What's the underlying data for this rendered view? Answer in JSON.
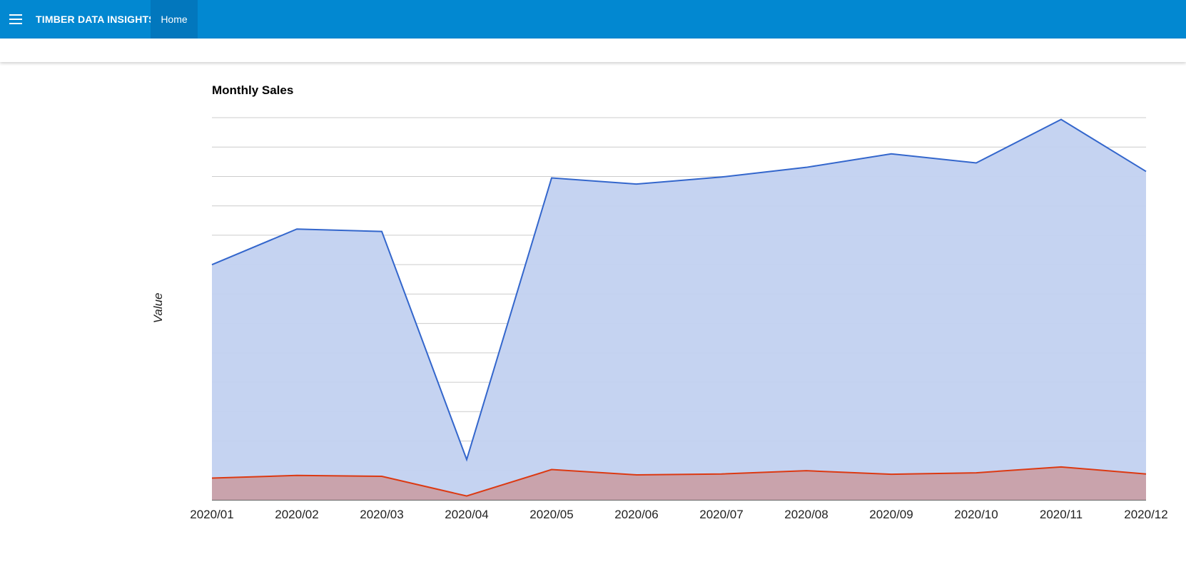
{
  "app": {
    "title": "TIMBER DATA INSIGHTS"
  },
  "nav": {
    "home_label": "Home"
  },
  "icons": {
    "menu": "menu-icon"
  },
  "colors": {
    "appbar": "#0288d1",
    "nav_active": "#0277bd",
    "series_1": "#3366cc",
    "series_1_fill": "#c2d1f0",
    "series_2": "#dc3912",
    "series_2_fill": "#c9a0a8"
  },
  "chart_data": {
    "type": "area",
    "title": "Monthly Sales",
    "ylabel": "Value",
    "xlabel": "",
    "categories": [
      "2020/01",
      "2020/02",
      "2020/03",
      "2020/04",
      "2020/05",
      "2020/06",
      "2020/07",
      "2020/08",
      "2020/09",
      "2020/10",
      "2020/11",
      "2020/12"
    ],
    "series": [
      {
        "values": [
          80,
          92.1,
          91.3,
          13.7,
          109.5,
          107.4,
          109.8,
          113.1,
          117.7,
          114.6,
          129.4,
          111.7
        ]
      },
      {
        "values": [
          7.4,
          8.3,
          8.0,
          1.3,
          10.3,
          8.5,
          8.8,
          9.9,
          8.7,
          9.2,
          11.2,
          8.8
        ]
      }
    ],
    "ylim": [
      0,
      130
    ],
    "gridlines": 13,
    "grid": true,
    "legend": "none"
  }
}
